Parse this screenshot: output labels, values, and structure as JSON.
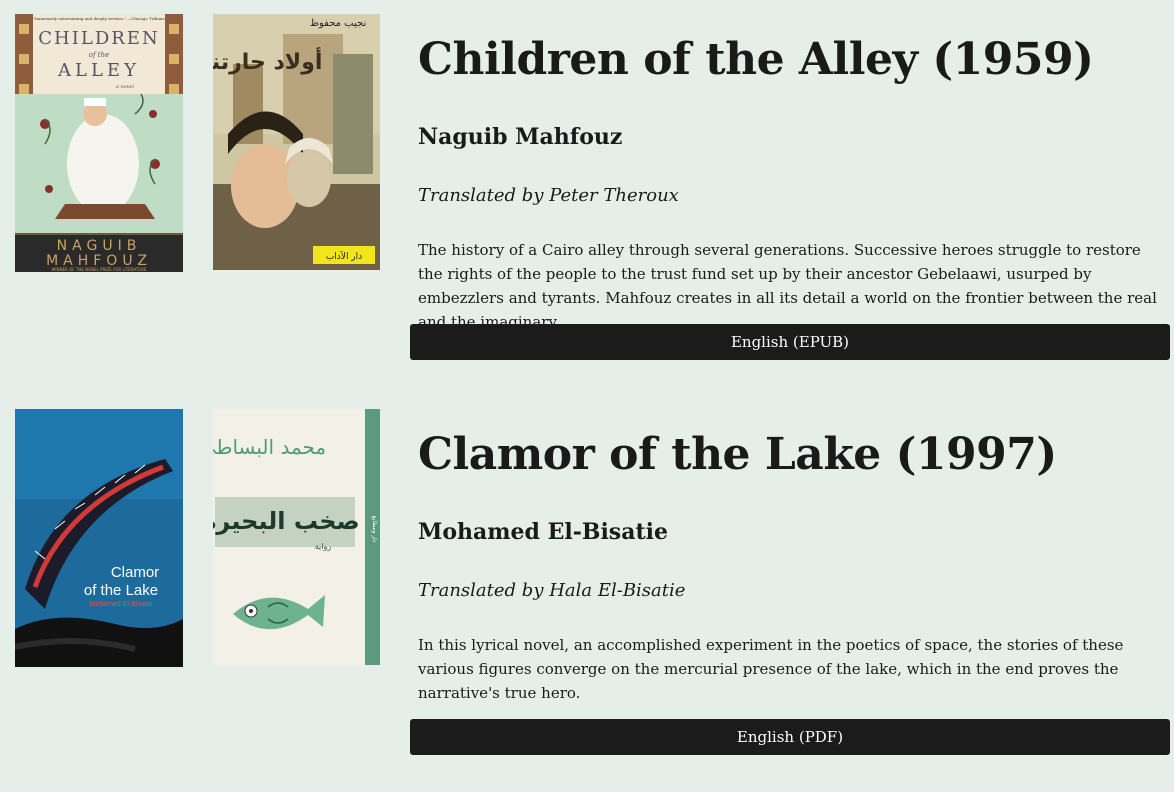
{
  "books": [
    {
      "title": "Children of the Alley (1959)",
      "author": "Naguib Mahfouz",
      "translator": "Translated by Peter Theroux",
      "description": "The history of a Cairo alley through several generations. Successive heroes struggle to restore the rights of the people to the trust fund set up by their ancestor Gebelaawi, usurped by embezzlers and tyrants. Mahfouz creates in all its detail a world on the frontier between the real and the imaginary.",
      "download_label": "English (EPUB)",
      "covers": {
        "english": {
          "blurb": "\"Immensely entertaining and deeply serious.\" —Chicago Tribune",
          "line1": "CHILDREN",
          "line2": "of the",
          "line3": "ALLEY",
          "sub": "a novel",
          "author_line1": "NAGUIB",
          "author_line2": "MAHFOUZ",
          "award": "WINNER OF THE NOBEL PRIZE FOR LITERATURE"
        },
        "arabic": {
          "author": "نجيب محفوظ",
          "title": "أولاد حارتنا",
          "publisher": "دار الآداب"
        }
      }
    },
    {
      "title": "Clamor of the Lake (1997)",
      "author": "Mohamed El-Bisatie",
      "translator": "Translated by Hala El-Bisatie",
      "description": "In this lyrical novel, an accomplished experiment in the poetics of space, the stories of these various figures converge on the mercurial presence of the lake, which in the end proves the narrative's true hero.",
      "download_label": "English (PDF)",
      "covers": {
        "english": {
          "line1": "Clamor",
          "line2": "of the Lake",
          "author": "Mohamed El-Bisatie"
        },
        "arabic": {
          "author": "محمد البساطي",
          "title": "صخب البحيرة",
          "sub": "رواية",
          "spine": "دار ومطابع"
        }
      }
    }
  ]
}
